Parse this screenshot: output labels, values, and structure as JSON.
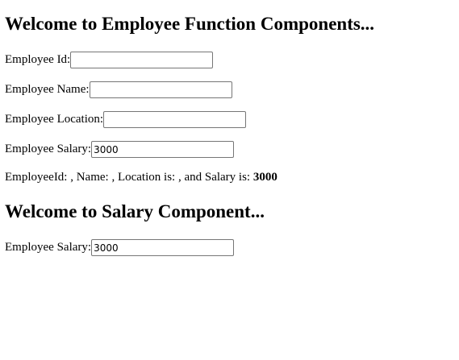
{
  "employee_section": {
    "heading": "Welcome to Employee Function Components...",
    "fields": {
      "id": {
        "label": "Employee Id:",
        "value": ""
      },
      "name": {
        "label": "Employee Name:",
        "value": ""
      },
      "location": {
        "label": "Employee Location:",
        "value": ""
      },
      "salary": {
        "label": "Employee Salary:",
        "value": "3000"
      }
    },
    "summary": {
      "prefix": "EmployeeId: , Name: , Location is: , and Salary is: ",
      "salary": "3000"
    }
  },
  "salary_section": {
    "heading": "Welcome to Salary Component...",
    "field": {
      "label": "Employee Salary:",
      "value": "3000"
    }
  }
}
